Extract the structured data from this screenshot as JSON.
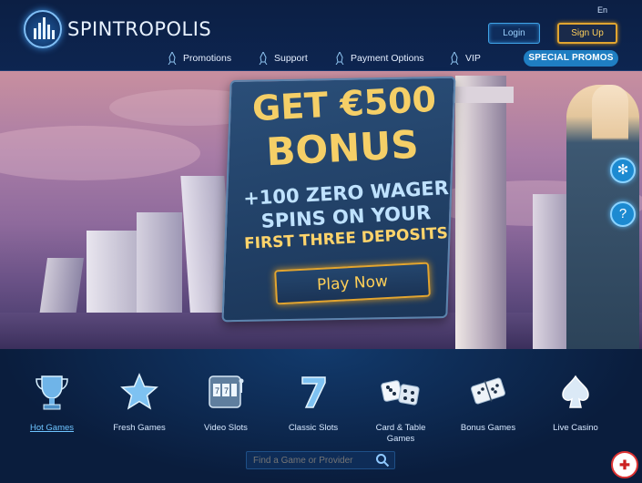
{
  "brand": {
    "name": "SPINTROPOLIS"
  },
  "header": {
    "language": "En",
    "login_label": "Login",
    "signup_label": "Sign Up"
  },
  "nav": {
    "items": [
      {
        "label": "Promotions",
        "icon": "rocket-icon"
      },
      {
        "label": "Support",
        "icon": "rocket-icon"
      },
      {
        "label": "Payment Options",
        "icon": "rocket-icon"
      },
      {
        "label": "VIP",
        "icon": "rocket-icon"
      }
    ],
    "special_label": "SPECIAL PROMOS"
  },
  "promo": {
    "line1": "GET €500",
    "line2": "BONUS",
    "line3": "+100 ZERO WAGER",
    "line4": "SPINS ON YOUR",
    "line5": "FIRST THREE DEPOSITS",
    "cta_label": "Play Now"
  },
  "side_icons": [
    "snowflake-icon",
    "help-icon"
  ],
  "categories": [
    {
      "label": "Hot Games",
      "icon": "trophy-icon",
      "active": true
    },
    {
      "label": "Fresh Games",
      "icon": "star-icon",
      "active": false
    },
    {
      "label": "Video Slots",
      "icon": "slot-machine-icon",
      "active": false
    },
    {
      "label": "Classic Slots",
      "icon": "seven-icon",
      "active": false
    },
    {
      "label": "Card & Table Games",
      "icon": "dice-icon",
      "active": false
    },
    {
      "label": "Bonus Games",
      "icon": "domino-icon",
      "active": false
    },
    {
      "label": "Live Casino",
      "icon": "spade-card-icon",
      "active": false
    }
  ],
  "search": {
    "placeholder": "Find a Game or Provider"
  },
  "colors": {
    "accent_blue": "#1f7ec2",
    "accent_gold": "#f5cf67",
    "bg_dark": "#0a1a35"
  }
}
